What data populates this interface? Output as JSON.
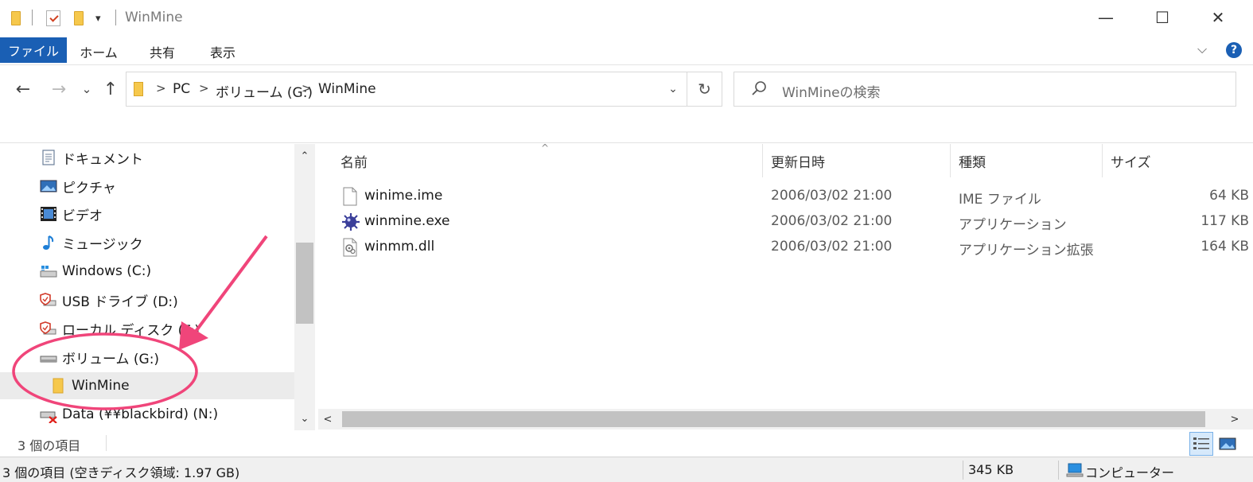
{
  "window": {
    "title": "WinMine",
    "minimize_glyph": "—",
    "maximize_glyph": "☐",
    "close_glyph": "✕",
    "qat_dropdown_glyph": "▾"
  },
  "ribbon": {
    "tabs": [
      {
        "label": "ファイル",
        "active": true
      },
      {
        "label": "ホーム"
      },
      {
        "label": "共有"
      },
      {
        "label": "表示"
      }
    ],
    "help_glyph": "?",
    "expand_glyph": "⌵"
  },
  "nav": {
    "back_glyph": "←",
    "forward_glyph": "→",
    "recent_glyph": "⌄",
    "up_glyph": "↑"
  },
  "address": {
    "crumbs": [
      "PC",
      "ボリューム (G:)",
      "WinMine"
    ],
    "separator": ">",
    "dropdown_glyph": "⌄",
    "refresh_glyph": "↻"
  },
  "search": {
    "placeholder": "WinMineの検索"
  },
  "navpane": {
    "items": [
      {
        "label": "ドキュメント",
        "icon": "document-icon"
      },
      {
        "label": "ピクチャ",
        "icon": "picture-icon"
      },
      {
        "label": "ビデオ",
        "icon": "video-icon"
      },
      {
        "label": "ミュージック",
        "icon": "music-icon"
      },
      {
        "label": "Windows (C:)",
        "icon": "windows-drive-icon"
      },
      {
        "label": "USB ドライブ (D:)",
        "icon": "usb-drive-icon"
      },
      {
        "label": "ローカル ディスク (F:)",
        "icon": "local-disk-icon"
      },
      {
        "label": "ボリューム (G:)",
        "icon": "drive-icon"
      },
      {
        "label": "WinMine",
        "icon": "folder-icon",
        "selected": true
      },
      {
        "label": "Data (¥¥blackbird) (N:)",
        "icon": "network-drive-disconnected-icon"
      }
    ],
    "scroll_up_glyph": "⌃",
    "scroll_down_glyph": "⌄"
  },
  "files": {
    "columns": [
      "名前",
      "更新日時",
      "種類",
      "サイズ"
    ],
    "sort_glyph": "^",
    "rows": [
      {
        "name": "winime.ime",
        "modified": "2006/03/02 21:00",
        "type": "IME ファイル",
        "size": "64 KB",
        "icon": "blank-file-icon"
      },
      {
        "name": "winmine.exe",
        "modified": "2006/03/02 21:00",
        "type": "アプリケーション",
        "size": "117 KB",
        "icon": "mine-app-icon"
      },
      {
        "name": "winmm.dll",
        "modified": "2006/03/02 21:00",
        "type": "アプリケーション拡張",
        "size": "164 KB",
        "icon": "dll-file-icon"
      }
    ],
    "hscroll_left_glyph": "<",
    "hscroll_right_glyph": ">"
  },
  "status": {
    "item_count": "3 個の項目",
    "bar_left": "3 個の項目 (空きディスク領域: 1.97 GB)",
    "bar_size": "345 KB",
    "bar_location": "コンピューター"
  },
  "colors": {
    "file_tab": "#1a5fb4",
    "annotation": "#f0457a",
    "selection": "#ebebeb"
  }
}
